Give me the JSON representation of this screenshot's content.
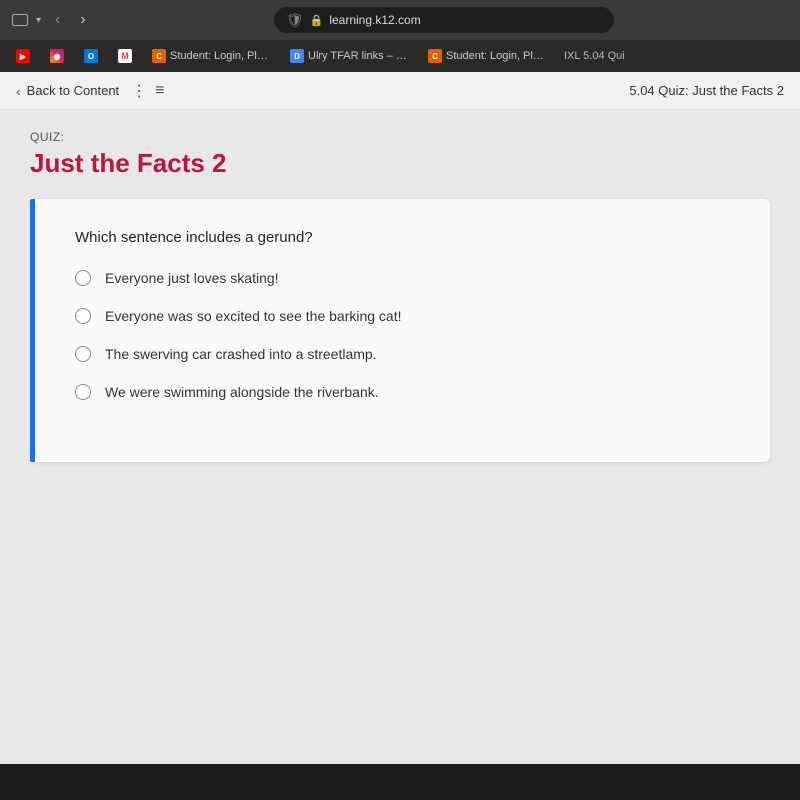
{
  "browser": {
    "url": "learning.k12.com",
    "tabs": [
      {
        "id": "yt",
        "favicon_type": "yt",
        "favicon_text": "▶",
        "label": ""
      },
      {
        "id": "ig",
        "favicon_type": "ig",
        "favicon_text": "◉",
        "label": ""
      },
      {
        "id": "outlook",
        "favicon_type": "outlook",
        "favicon_text": "O",
        "label": ""
      },
      {
        "id": "gmail",
        "favicon_type": "gmail",
        "favicon_text": "M",
        "label": ""
      },
      {
        "id": "canvas1",
        "favicon_type": "canvas",
        "favicon_text": "C",
        "label": "Student: Login, Please Sig..."
      },
      {
        "id": "docs",
        "favicon_type": "docs",
        "favicon_text": "D",
        "label": "Ulry TFAR links – Google D..."
      },
      {
        "id": "canvas2",
        "favicon_type": "canvas2",
        "favicon_text": "C",
        "label": "Student: Login, Please Sig..."
      }
    ],
    "tab_extra": "IXL  5.04 Qui"
  },
  "toolbar": {
    "back_label": "Back to Content",
    "page_title": "5.04 Quiz: Just the Facts 2"
  },
  "quiz": {
    "label": "QUIZ:",
    "title": "Just the Facts 2",
    "question": "Which sentence includes a gerund?",
    "options": [
      {
        "id": "a",
        "text": "Everyone just loves skating!"
      },
      {
        "id": "b",
        "text": "Everyone was so excited to see the barking cat!"
      },
      {
        "id": "c",
        "text": "The swerving car crashed into a streetlamp."
      },
      {
        "id": "d",
        "text": "We were swimming alongside the riverbank."
      }
    ]
  }
}
